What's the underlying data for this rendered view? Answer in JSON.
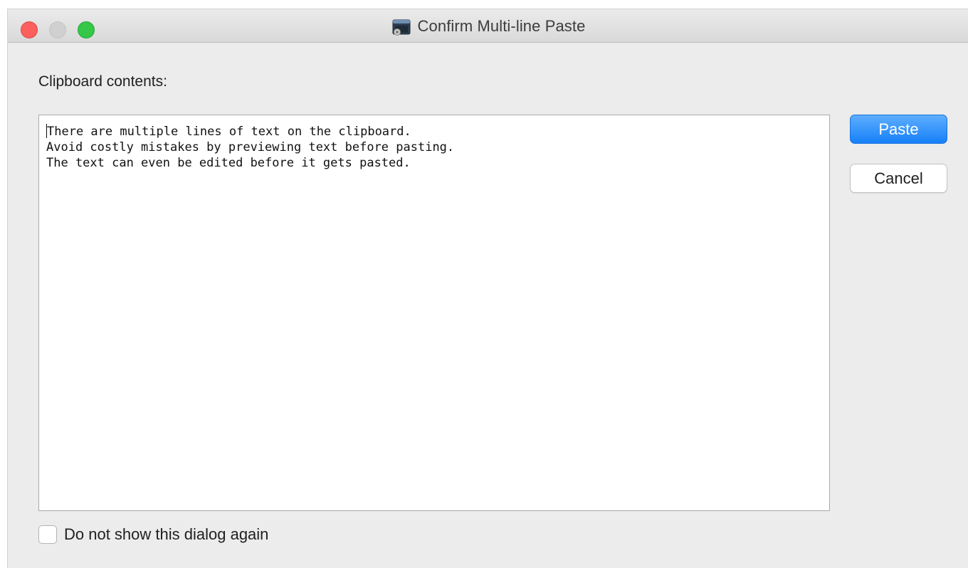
{
  "window": {
    "title": "Confirm Multi-line Paste",
    "title_icon": "terminal-app-icon"
  },
  "traffic_lights": {
    "close_color": "#fc605c",
    "minimize_color": "#d0d0d0",
    "zoom_color": "#34c748"
  },
  "content": {
    "label": "Clipboard contents:",
    "lines": [
      "There are multiple lines of text on the clipboard.",
      "Avoid costly mistakes by previewing text before pasting.",
      "The text can even be edited before it gets pasted."
    ]
  },
  "buttons": {
    "paste_label": "Paste",
    "cancel_label": "Cancel",
    "accent_color": "#1680f9"
  },
  "checkbox": {
    "label": "Do not show this dialog again",
    "checked": false
  }
}
